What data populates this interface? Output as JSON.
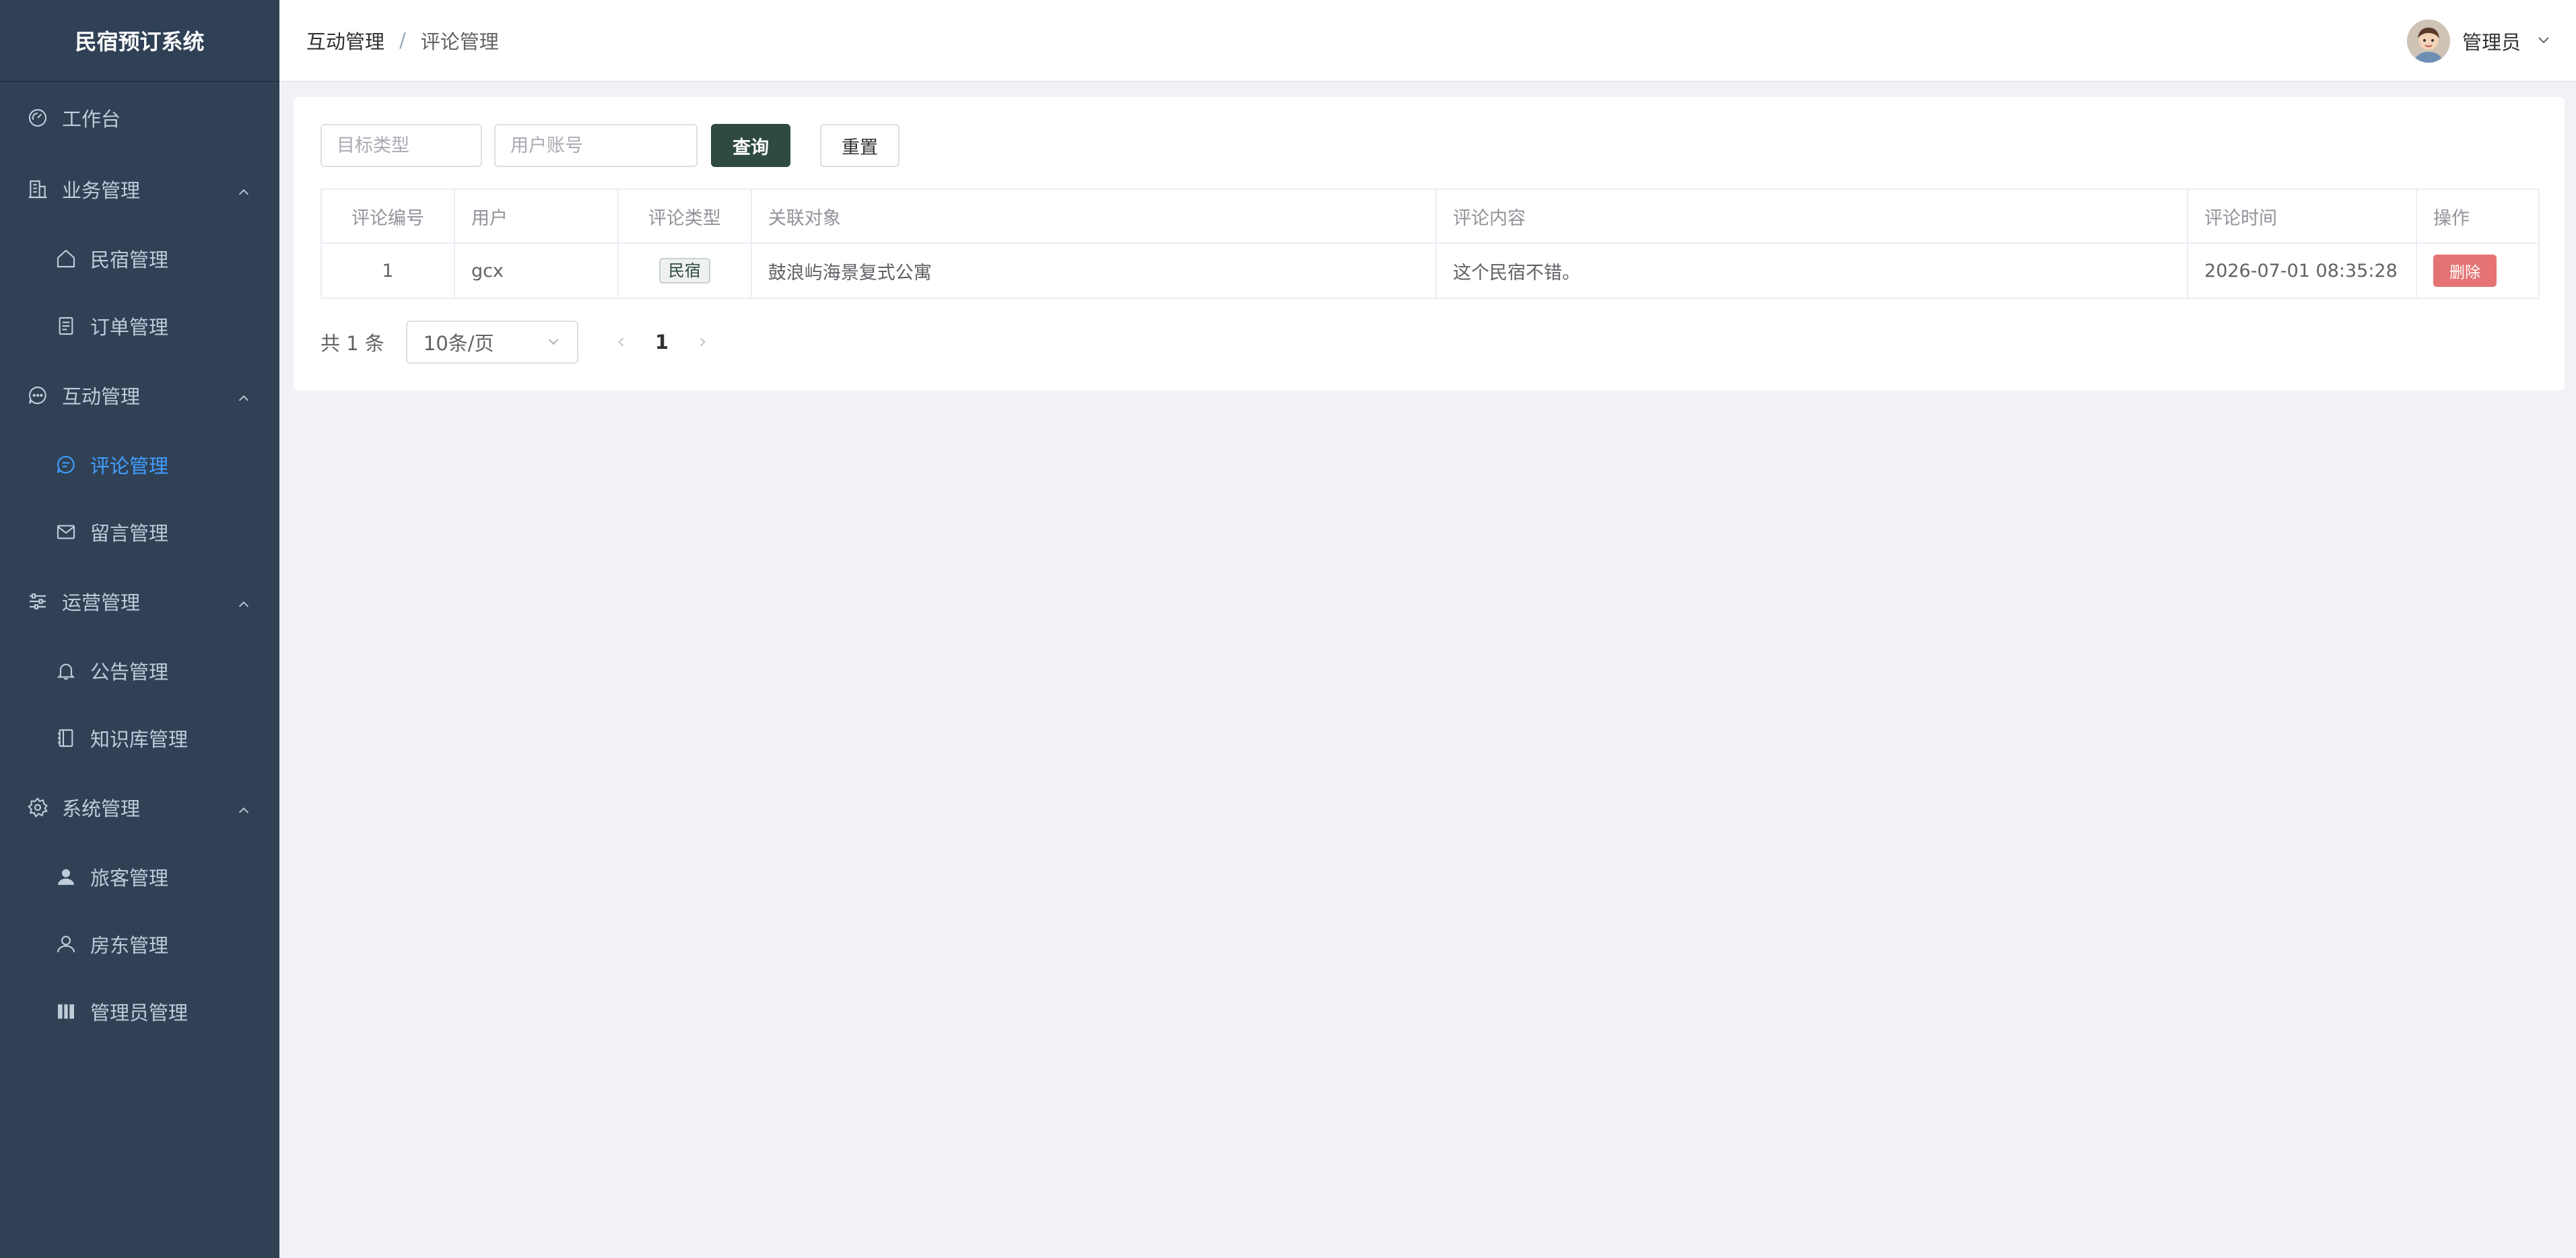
{
  "app": {
    "title": "民宿预订系统"
  },
  "sidebar": {
    "items": [
      {
        "label": "工作台",
        "icon": "dashboard-icon",
        "level": "top"
      },
      {
        "label": "业务管理",
        "icon": "building-icon",
        "level": "top",
        "expanded": true
      },
      {
        "label": "民宿管理",
        "icon": "home-icon",
        "level": "sub"
      },
      {
        "label": "订单管理",
        "icon": "document-icon",
        "level": "sub"
      },
      {
        "label": "互动管理",
        "icon": "chat-dots-icon",
        "level": "top",
        "expanded": true
      },
      {
        "label": "评论管理",
        "icon": "comment-icon",
        "level": "sub",
        "active": true
      },
      {
        "label": "留言管理",
        "icon": "message-icon",
        "level": "sub"
      },
      {
        "label": "运营管理",
        "icon": "sliders-icon",
        "level": "top",
        "expanded": true
      },
      {
        "label": "公告管理",
        "icon": "bell-icon",
        "level": "sub"
      },
      {
        "label": "知识库管理",
        "icon": "notebook-icon",
        "level": "sub"
      },
      {
        "label": "系统管理",
        "icon": "gear-icon",
        "level": "top",
        "expanded": true
      },
      {
        "label": "旅客管理",
        "icon": "user-filled-icon",
        "level": "sub"
      },
      {
        "label": "房东管理",
        "icon": "user-icon",
        "level": "sub"
      },
      {
        "label": "管理员管理",
        "icon": "management-icon",
        "level": "sub"
      }
    ]
  },
  "header": {
    "breadcrumb": {
      "parent": "互动管理",
      "separator": "/",
      "current": "评论管理"
    },
    "user_name": "管理员"
  },
  "filters": {
    "target_type_placeholder": "目标类型",
    "target_type_value": "",
    "user_account_placeholder": "用户账号",
    "user_account_value": "",
    "query_label": "查询",
    "reset_label": "重置"
  },
  "table": {
    "columns": [
      "评论编号",
      "用户",
      "评论类型",
      "关联对象",
      "评论内容",
      "评论时间",
      "操作"
    ],
    "rows": [
      {
        "id": "1",
        "user": "gcx",
        "type": "民宿",
        "target": "鼓浪屿海景复式公寓",
        "content": "这个民宿不错。",
        "time": "2026-07-01 08:35:28",
        "action": "删除"
      }
    ]
  },
  "pagination": {
    "total": "共 1 条",
    "page_size": "10条/页",
    "current_page": "1"
  },
  "colors": {
    "sidebar_bg": "#304156",
    "sidebar_text": "#bfcbd9",
    "active": "#409eff",
    "primary_button": "#2f4a3f",
    "danger": "#e57373",
    "page_bg": "#f0f2f5"
  }
}
